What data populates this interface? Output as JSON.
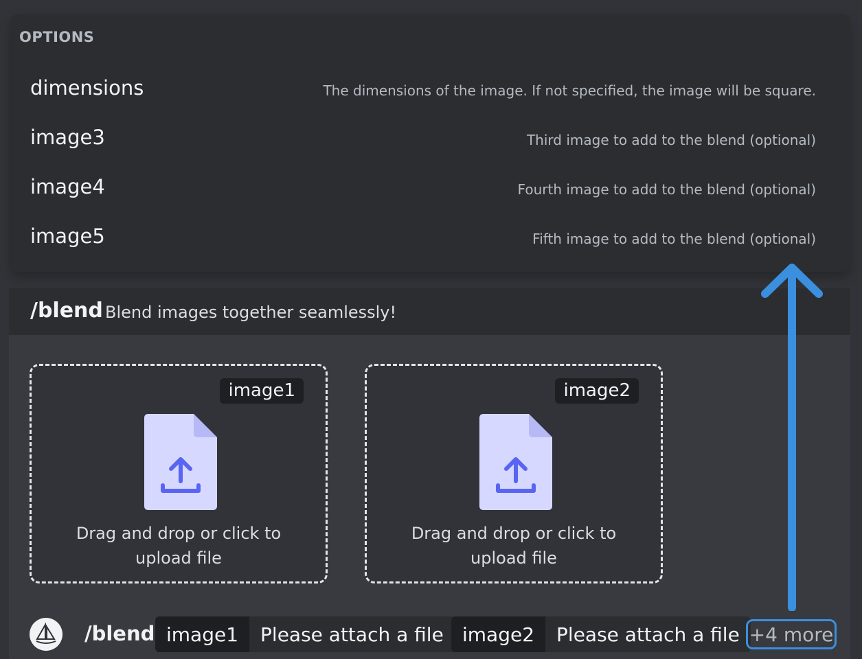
{
  "options": {
    "heading": "OPTIONS",
    "items": [
      {
        "name": "dimensions",
        "description": "The dimensions of the image. If not specified, the image will be square."
      },
      {
        "name": "image3",
        "description": "Third image to add to the blend (optional)"
      },
      {
        "name": "image4",
        "description": "Fourth image to add to the blend (optional)"
      },
      {
        "name": "image5",
        "description": "Fifth image to add to the blend (optional)"
      }
    ]
  },
  "command": {
    "name": "/blend",
    "description": "Blend images together seamlessly!"
  },
  "uploads": [
    {
      "tag": "image1",
      "text": "Drag and drop or click to upload file",
      "icon": "file-upload-icon"
    },
    {
      "tag": "image2",
      "text": "Drag and drop or click to upload file",
      "icon": "file-upload-icon"
    }
  ],
  "input_bar": {
    "command": "/blend",
    "params": [
      {
        "label": "image1",
        "value": "Please attach a file"
      },
      {
        "label": "image2",
        "value": "Please attach a file"
      }
    ],
    "more": "+4 more",
    "avatar_icon": "sailboat-icon"
  },
  "colors": {
    "accent": "#3b8fdf",
    "file_icon": "#d6d8ff",
    "file_icon_arrow": "#5865f2"
  }
}
